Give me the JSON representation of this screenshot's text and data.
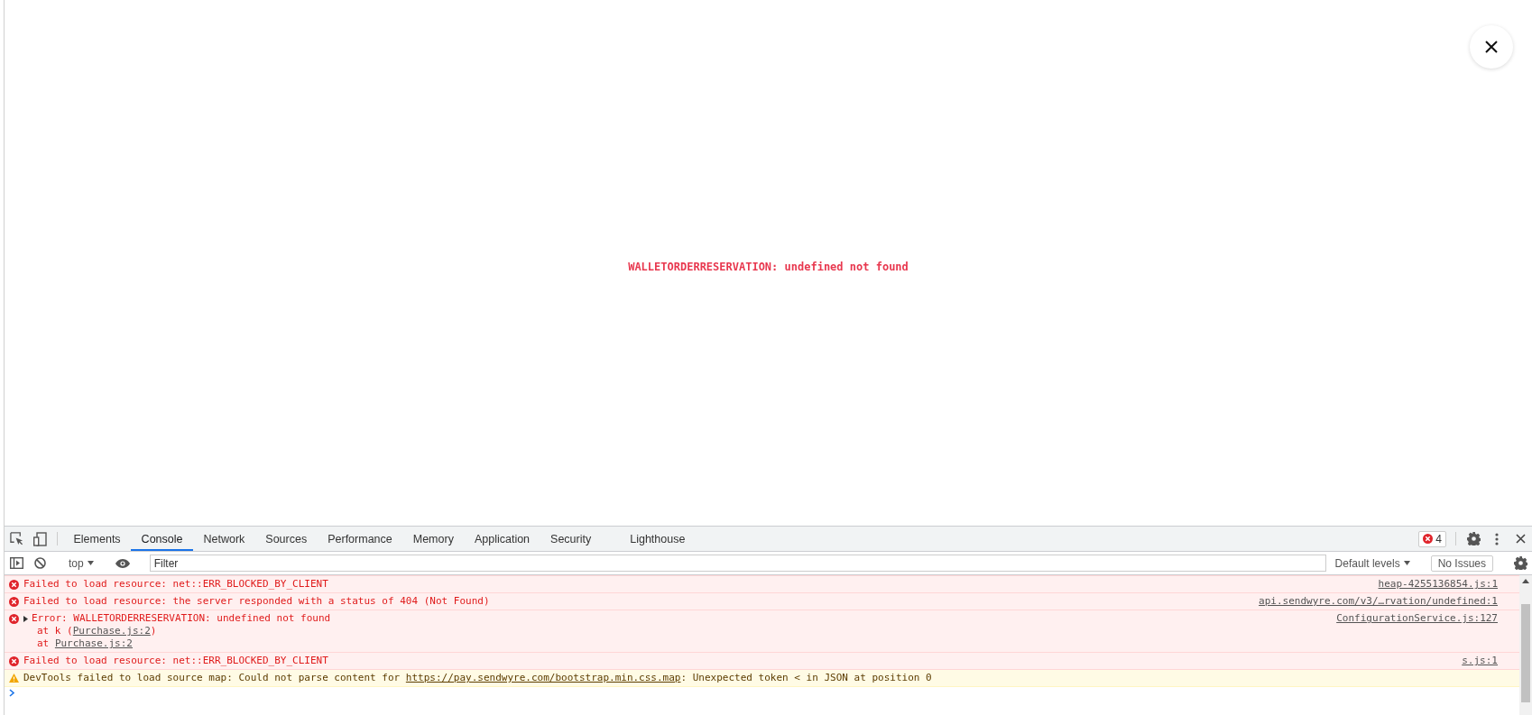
{
  "page": {
    "message": "WALLETORDERRESERVATION: undefined not found"
  },
  "devtools": {
    "tabs": [
      {
        "label": "Elements",
        "selected": false
      },
      {
        "label": "Console",
        "selected": true
      },
      {
        "label": "Network",
        "selected": false
      },
      {
        "label": "Sources",
        "selected": false
      },
      {
        "label": "Performance",
        "selected": false
      },
      {
        "label": "Memory",
        "selected": false
      },
      {
        "label": "Application",
        "selected": false
      },
      {
        "label": "Security",
        "selected": false
      },
      {
        "label": "Lighthouse",
        "selected": false
      }
    ],
    "error_count": "4",
    "context": "top",
    "filter": {
      "placeholder": "Filter"
    },
    "levels": "Default levels",
    "issues": "No Issues",
    "messages": [
      {
        "kind": "error",
        "text": "Failed to load resource: net::ERR_BLOCKED_BY_CLIENT",
        "source": "heap-4255136854.js:1"
      },
      {
        "kind": "error",
        "text": "Failed to load resource: the server responded with a status of 404 (Not Found)",
        "source": "api.sendwyre.com/v3/…rvation/undefined:1"
      },
      {
        "kind": "error",
        "text": "Error: WALLETORDERRESERVATION: undefined not found",
        "source": "ConfigurationService.js:127",
        "expanded": false,
        "stack": [
          {
            "before": "at k (",
            "link": "Purchase.js:2",
            "after": ")"
          },
          {
            "before": "at ",
            "link": "Purchase.js:2"
          }
        ]
      },
      {
        "kind": "error",
        "text": "Failed to load resource: net::ERR_BLOCKED_BY_CLIENT",
        "source": "s.js:1"
      },
      {
        "kind": "warning",
        "text": "DevTools failed to load source map: Could not parse content for ",
        "link": "https://pay.sendwyre.com/bootstrap.min.css.map",
        "after": ": Unexpected token < in JSON at position 0"
      }
    ]
  }
}
